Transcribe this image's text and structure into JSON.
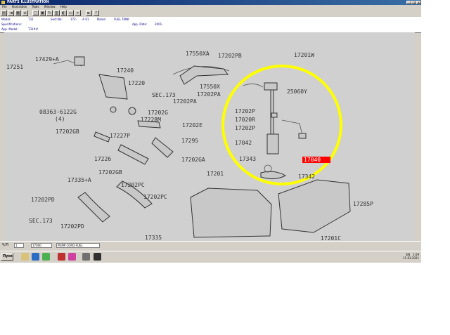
{
  "window": {
    "title": "PARTS ILLUSTRATION",
    "min_glyph": "_",
    "max_glyph": "□",
    "close_glyph": "x"
  },
  "menu": [
    "File",
    "Illustration",
    "Tools",
    "Window",
    "Help"
  ],
  "info": {
    "model_label": "Model:",
    "model_value": "T31",
    "sect_label": "Sect.No:",
    "sect_value": "172-",
    "sect_desc": "-A 01",
    "name_label": "Name:",
    "name_value": "FUEL TANK",
    "spec_label": "Specifications:",
    "app_model_label": "App. Model:",
    "app_model_value": "T31##",
    "app_date_label": "App. Date:",
    "app_date_value": "2001-"
  },
  "diagram": {
    "labels": [
      "17251",
      "17429+A",
      "17240",
      "17220",
      "SEC.173",
      "17550XA",
      "17202PB",
      "17201W",
      "17550X",
      "17202PA",
      "17202PA",
      "25060Y",
      "08363-6122G",
      "(4)",
      "17202G",
      "17228M",
      "17202E",
      "17202GB",
      "17227P",
      "17295",
      "17202P",
      "17020R",
      "17202P",
      "17042",
      "17226",
      "17202GA",
      "17343",
      "17040",
      "17202GB",
      "17201",
      "17342",
      "17335+A",
      "17202PC",
      "17202PC",
      "17285P",
      "17202PD",
      "SEC.173",
      "17202PD",
      "17335",
      "17201C"
    ]
  },
  "status": {
    "page_label": "Ч/Л",
    "page_value": "1",
    "part_no": "17040",
    "part_name": "PUMP CORD-FUEL"
  },
  "taskbar": {
    "start_label": "Пуск",
    "lang": "EN",
    "time": "1:09",
    "date": "11.03.2021"
  },
  "colors": {
    "highlight_circle": "#ffff00",
    "selected_label": "#ff0000",
    "titlebar": "#0a246a"
  }
}
